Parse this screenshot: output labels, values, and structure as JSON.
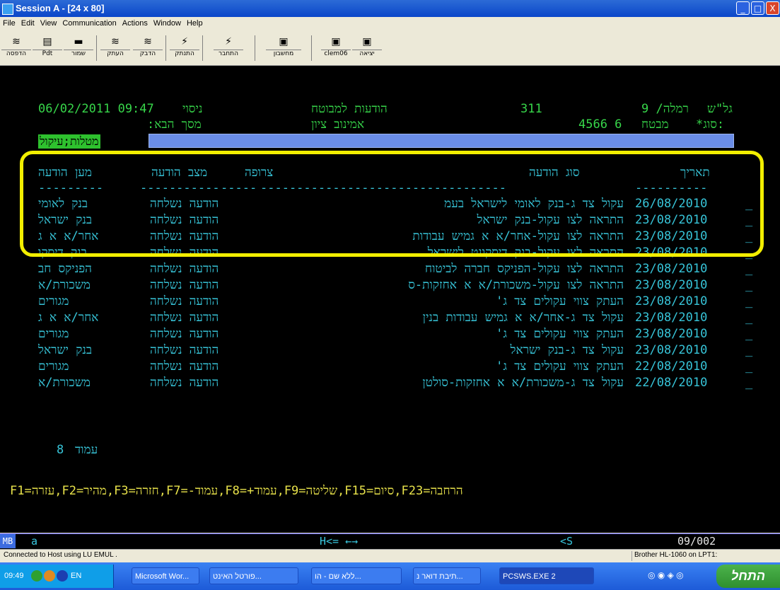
{
  "window": {
    "title": "Session A - [24 x 80]",
    "minimize_glyph": "_",
    "maximize_glyph": "□",
    "close_glyph": "X"
  },
  "menu": [
    "File",
    "Edit",
    "View",
    "Communication",
    "Actions",
    "Window",
    "Help"
  ],
  "toolbar": [
    {
      "label": "הדפסה",
      "icon": "print-icon"
    },
    {
      "label": "Pdt",
      "icon": "pdt-icon"
    },
    {
      "label": "שמור",
      "icon": "save-icon"
    },
    {
      "label": "העתק",
      "icon": "copy-icon"
    },
    {
      "label": "הדבק",
      "icon": "paste-icon"
    },
    {
      "label": "התנתק",
      "icon": "disconnect-icon"
    },
    {
      "label": "התחבר",
      "icon": "connect-icon"
    },
    {
      "label": "מחשבון",
      "icon": "calculator-icon"
    },
    {
      "label": "clem06",
      "icon": "clem06-icon"
    },
    {
      "label": "יציאה",
      "icon": "exit-icon"
    }
  ],
  "header": {
    "datetime": "06/02/2011 09:47",
    "env": "ניסוי",
    "screen_title": "הודעות למבוטח",
    "screen_code": "311",
    "branch_label": "גל\"ש",
    "branch_value": "רמלה/ 9",
    "next_screen_label": "מסך הבא:",
    "insured_name": "אמינוב ציון",
    "policy_number": "4566 6",
    "type_label": "*סוג:",
    "type_value": "מבטח",
    "filter_label": "מטלות;עיקול"
  },
  "columns": {
    "addressee": "מען הודעה",
    "status": "מצב הודעה",
    "attachment": "צרופה",
    "type": "סוג הודעה",
    "date": "תאריך",
    "sep_addressee": "---------",
    "sep_status": "-----------",
    "sep_attachment": "-----",
    "sep_type": "----------------------------------",
    "sep_date": "----------"
  },
  "rows": [
    {
      "addressee": "בנק לאומי",
      "status": "הודעה נשלחה",
      "type": "עקול צד ג-בנק לאומי לישראל בעמ",
      "date": "26/08/2010",
      "sel": "_"
    },
    {
      "addressee": "בנק ישראל",
      "status": "הודעה נשלחה",
      "type": "התראה לצו עקול-בנק ישראל",
      "date": "23/08/2010",
      "sel": "_"
    },
    {
      "addressee": "אחר/א א ג",
      "status": "הודעה נשלחה",
      "type": "התראה לצו עקול-אחר/א א גמיש עבודות",
      "date": "23/08/2010",
      "sel": "_"
    },
    {
      "addressee": "בנק דיסקו",
      "status": "הודעה נשלחה",
      "type": "התראה לצו עקול-בנק דיסקונט לישראל",
      "date": "23/08/2010",
      "sel": "_"
    },
    {
      "addressee": "הפניקס חב",
      "status": "הודעה נשלחה",
      "type": "התראה לצו עקול-הפניקס חברה לביטוח",
      "date": "23/08/2010",
      "sel": "_"
    },
    {
      "addressee": "משכורת/א",
      "status": "הודעה נשלחה",
      "type": "התראה לצו עקול-משכורת/א א אחזקות-ס",
      "date": "23/08/2010",
      "sel": "_"
    },
    {
      "addressee": "מגורים",
      "status": "הודעה נשלחה",
      "type": "העתק צווי עקולים צד ג'",
      "date": "23/08/2010",
      "sel": "_"
    },
    {
      "addressee": "אחר/א א ג",
      "status": "הודעה נשלחה",
      "type": "עקול צד ג-אחר/א א גמיש עבודות בנין",
      "date": "23/08/2010",
      "sel": "_"
    },
    {
      "addressee": "מגורים",
      "status": "הודעה נשלחה",
      "type": "העתק צווי עקולים צד ג'",
      "date": "23/08/2010",
      "sel": "_"
    },
    {
      "addressee": "בנק ישראל",
      "status": "הודעה נשלחה",
      "type": "עקול צד ג-בנק ישראל",
      "date": "23/08/2010",
      "sel": "_"
    },
    {
      "addressee": "מגורים",
      "status": "הודעה נשלחה",
      "type": "העתק צווי עקולים צד ג'",
      "date": "22/08/2010",
      "sel": "_"
    },
    {
      "addressee": "משכורת/א",
      "status": "הודעה נשלחה",
      "type": "עקול צד ג-משכורת/א א אחזקות-סולטן",
      "date": "22/08/2010",
      "sel": "_"
    }
  ],
  "page": {
    "label": "עמוד",
    "number": "8"
  },
  "fkeys": "הרחבה=F23,סיום=F15,שליטה=F9,עמוד+=F8,עמוד-=F7,חזרה=F3,מהיר=F2,עזרה=F1",
  "oia": {
    "mb": "MB",
    "a": "a",
    "mode": "H<= ←→",
    "s": "<S",
    "pos": "09/002"
  },
  "status": {
    "left": "Connected to Host using LU EMUL .",
    "right": "Brother HL-1060 on LPT1:"
  },
  "taskbar": {
    "start": "התחל",
    "clock": "09:49",
    "lang": "EN",
    "tasks": [
      "Microsoft Wor...",
      "פורטל האינט...",
      "ללא שם - הו...",
      "תיבת דואר נ...",
      "PCSWS.EXE 2"
    ]
  },
  "colors": {
    "terminal_bg": "#000000",
    "text_cyan": "#3ad6e6",
    "text_green": "#37d64a",
    "highlight": "#f2ee00",
    "filter_bar": "#6a8de8"
  }
}
